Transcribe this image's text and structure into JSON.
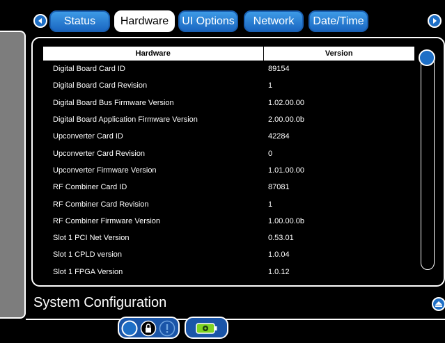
{
  "tabs": [
    {
      "label": "Status"
    },
    {
      "label": "Hardware",
      "active": true
    },
    {
      "label": "UI Options"
    },
    {
      "label": "Network"
    },
    {
      "label": "Date/Time"
    }
  ],
  "table": {
    "headers": [
      "Hardware",
      "Version"
    ],
    "rows": [
      [
        "Digital Board Card ID",
        "89154"
      ],
      [
        "Digital Board Card Revision",
        "1"
      ],
      [
        "Digital Board Bus Firmware Version",
        "1.02.00.00"
      ],
      [
        "Digital Board Application Firmware Version",
        "2.00.00.0b"
      ],
      [
        "Upconverter Card ID",
        "42284"
      ],
      [
        "Upconverter Card Revision",
        "0"
      ],
      [
        "Upconverter Firmware Version",
        "1.01.00.00"
      ],
      [
        "RF Combiner Card ID",
        "87081"
      ],
      [
        "RF Combiner Card Revision",
        "1"
      ],
      [
        "RF Combiner Firmware Version",
        "1.00.00.0b"
      ],
      [
        "Slot 1 PCI Net Version",
        "0.53.01"
      ],
      [
        "Slot 1 CPLD version",
        "1.0.04"
      ],
      [
        "Slot 1 FPGA Version",
        "1.0.12"
      ]
    ]
  },
  "footer": {
    "title": "System Configuration"
  },
  "colors": {
    "accent": "#1e6fc6",
    "battery": "#7ed321"
  },
  "icons": [
    "left-arrow-icon",
    "right-arrow-icon",
    "up-arrow-icon",
    "lock-icon",
    "info-icon",
    "battery-icon"
  ]
}
